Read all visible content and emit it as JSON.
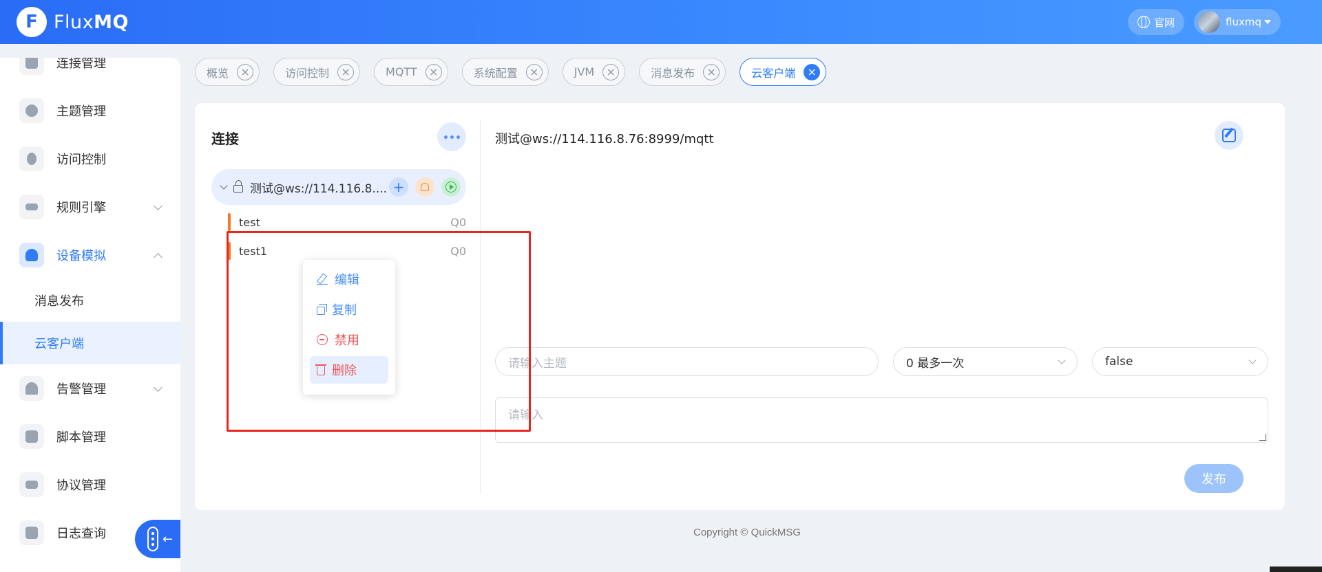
{
  "header": {
    "logo_letter": "F",
    "logo_text_plain": "Flux",
    "logo_text_bold": "MQ",
    "official_site": "官网",
    "username": "fluxmq"
  },
  "sidebar": {
    "items": [
      {
        "label": "连接管理",
        "icon": "link-icon"
      },
      {
        "label": "主题管理",
        "icon": "topic-icon"
      },
      {
        "label": "访问控制",
        "icon": "access-icon"
      },
      {
        "label": "规则引擎",
        "icon": "rule-engine-icon"
      },
      {
        "label": "设备模拟",
        "icon": "cloud-device-icon"
      },
      {
        "label": "告警管理",
        "icon": "alarm-icon"
      },
      {
        "label": "脚本管理",
        "icon": "script-icon"
      },
      {
        "label": "协议管理",
        "icon": "protocol-icon"
      },
      {
        "label": "日志查询",
        "icon": "log-search-icon"
      }
    ],
    "sub_items": [
      {
        "label": "消息发布"
      },
      {
        "label": "云客户端"
      }
    ]
  },
  "tabs": [
    {
      "label": "概览"
    },
    {
      "label": "访问控制"
    },
    {
      "label": "MQTT"
    },
    {
      "label": "系统配置"
    },
    {
      "label": "JVM"
    },
    {
      "label": "消息发布"
    },
    {
      "label": "云客户端",
      "active": true
    }
  ],
  "left_pane": {
    "title": "连接",
    "connection": "测试@ws://114.116.8....",
    "subscriptions": [
      {
        "topic": "test",
        "qos": "Q0"
      },
      {
        "topic": "test1",
        "qos": "Q0"
      }
    ]
  },
  "context_menu": {
    "edit": "编辑",
    "copy": "复制",
    "disable": "禁用",
    "delete": "删除"
  },
  "right_pane": {
    "title": "测试@ws://114.116.8.76:8999/mqtt",
    "topic_placeholder": "请输入主题",
    "qos_value": "0 最多一次",
    "retain_value": "false",
    "payload_placeholder": "请输入",
    "publish_label": "发布"
  },
  "footer": {
    "copyright": "Copyright © QuickMSG"
  },
  "colors": {
    "accent": "#2f7cf6",
    "header_start": "#2a6cf6",
    "highlight_box": "#e8261e",
    "subscription_bar": "#f47d24"
  }
}
